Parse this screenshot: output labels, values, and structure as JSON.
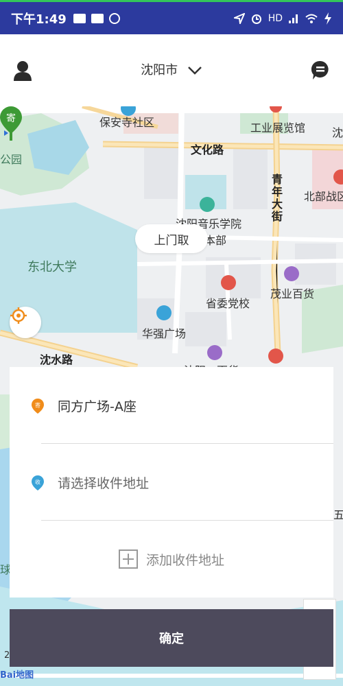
{
  "status_bar": {
    "time": "下午1:49",
    "network": "HD"
  },
  "header": {
    "city": "沈阳市",
    "icons": {
      "left": "user-icon",
      "city_dropdown": "chevron-down-icon",
      "right": "message-icon"
    }
  },
  "map": {
    "labels": {
      "baoansi": "保安寺社区",
      "gongye": "工业展览馆",
      "wenhua": "文化路",
      "qingnian": "青年大街",
      "beibu": "北部战区",
      "gongyuan": "公园",
      "yinyue": "沈阳音乐学院",
      "benbu": "本部",
      "dongbei": "东北大学",
      "shengwei": "省委党校",
      "maoye": "茂业百货",
      "huaqiang": "华强广场",
      "chenshui": "沈水路",
      "partial_bottom": "沈阳…百货…",
      "partial_right": "五",
      "partial_right2": "沈",
      "partial_ball": "球"
    },
    "tooltip": "上门取",
    "pin_label": "寄",
    "scale_text": "2",
    "logo_text": "Bai地图"
  },
  "address_card": {
    "sender_icon_label": "寄",
    "sender_address": "同方广场-A座",
    "receiver_icon_label": "收",
    "receiver_placeholder": "请选择收件地址",
    "add_label": "添加收件地址"
  },
  "confirm_button": "确定",
  "colors": {
    "status_bar": "#2c3a9e",
    "confirm_bg": "#4d4a5c",
    "sender_dot": "#f08c1a",
    "receiver_dot": "#3aa3d8",
    "pin": "#3d9a35"
  }
}
